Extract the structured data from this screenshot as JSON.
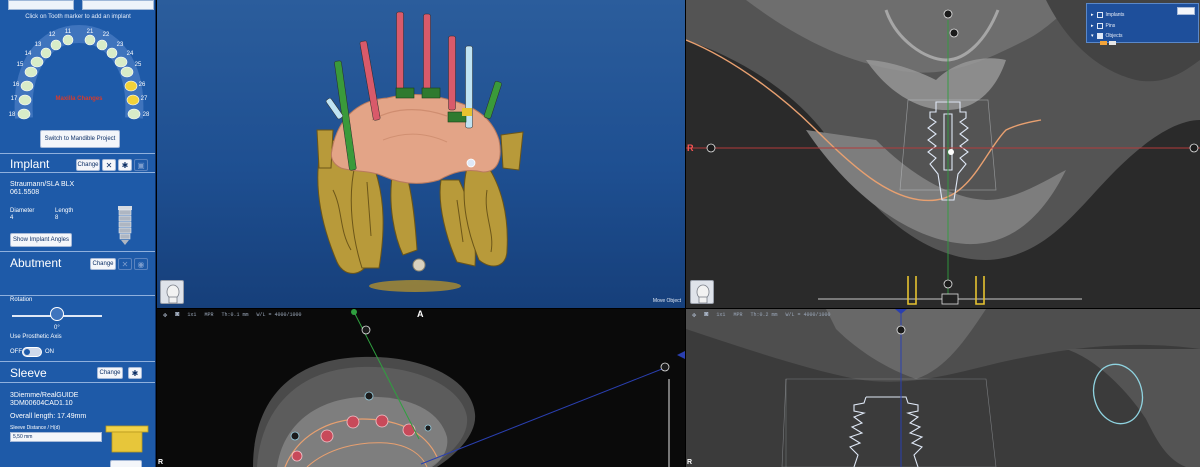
{
  "sidebar": {
    "hint": "Click on Tooth marker to add an implant",
    "teeth_upper": [
      "11",
      "12",
      "13",
      "14",
      "15",
      "16",
      "17",
      "18",
      "21",
      "22",
      "23",
      "24",
      "25",
      "26",
      "27",
      "28"
    ],
    "center_label": "Maxilla Changes",
    "mandible_button": "Switch to Mandible Project",
    "implant": {
      "title": "Implant",
      "change_label": "Change",
      "brand": "Straumann/SLA BLX",
      "code": "061.5508",
      "diameter_label": "Diameter",
      "diameter_value": "4",
      "length_label": "Length",
      "length_value": "8",
      "angles_button": "Show Implant Angles"
    },
    "abutment": {
      "title": "Abutment",
      "change_label": "Change",
      "rotation_label": "Rotation",
      "rotation_value": "0°",
      "prosthetic_axis_label": "Use Prosthetic Axis",
      "toggle_off": "OFF",
      "toggle_on": "ON"
    },
    "sleeve": {
      "title": "Sleeve",
      "change_label": "Change",
      "brand": "3Diemme/RealGUIDE",
      "code": "3DM00604CAD1.10",
      "overall_length": "Overall length: 17.49mm",
      "distance_label": "Sleeve Distance / H(d)",
      "distance_value": "5,50 mm"
    }
  },
  "viewport3d": {
    "move_object": "Move Object",
    "colors": {
      "red_pin": "#d95a6a",
      "green_pin": "#3a9a3a",
      "light_pin": "#bfe3f3",
      "bone": "#b89a3a",
      "gum": "#e3a487"
    }
  },
  "sagittal": {
    "left_letter": "R",
    "bottom_letter": "S",
    "objects_panel": {
      "items": [
        {
          "label": "Implants"
        },
        {
          "label": "Pins"
        },
        {
          "label": "Objects"
        }
      ]
    }
  },
  "axial": {
    "top_letter": "A",
    "toolbar": [
      "1x1",
      "MPR",
      "Th:0.1 mm",
      "W/L = 4000/1000"
    ],
    "bottom_left_letter": "R"
  },
  "coronal": {
    "toolbar": [
      "1x1",
      "MPR",
      "Th:0.2 mm",
      "W/L = 4000/1000"
    ],
    "bottom_left_letter": "R"
  }
}
